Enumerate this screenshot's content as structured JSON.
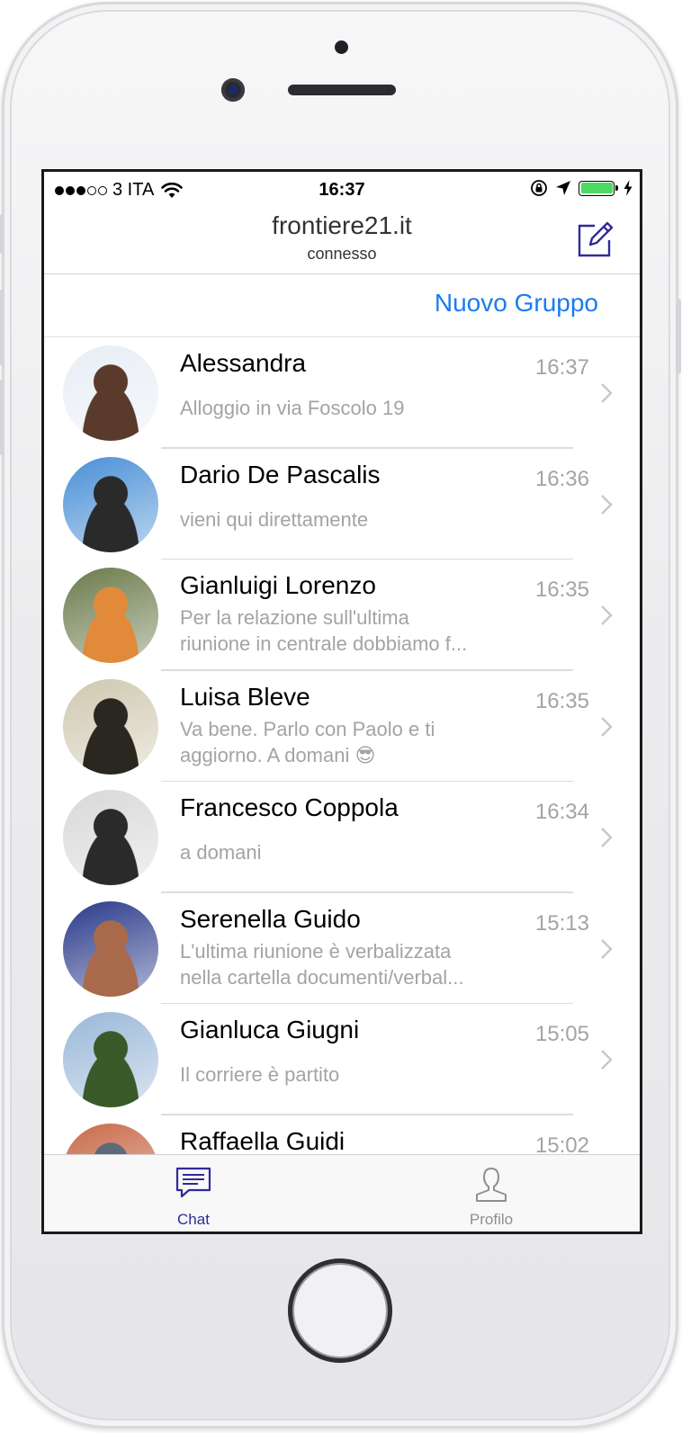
{
  "status_bar": {
    "carrier": "3 ITA",
    "time": "16:37",
    "signal_bars_filled": 3,
    "signal_bars_total": 5,
    "battery_level": 1.0
  },
  "header": {
    "title": "frontiere21.it",
    "subtitle": "connesso",
    "compose_icon": "compose-icon"
  },
  "actions": {
    "new_group_label": "Nuovo Gruppo"
  },
  "conversations": [
    {
      "name": "Alessandra",
      "time": "16:37",
      "preview": [
        "Alloggio in via Foscolo 19"
      ],
      "avatar_colors": [
        "#e8eef5",
        "#5a3a2a"
      ]
    },
    {
      "name": "Dario De Pascalis",
      "time": "16:36",
      "preview": [
        "vieni qui direttamente"
      ],
      "avatar_colors": [
        "#4a8fd6",
        "#2a2a2a"
      ]
    },
    {
      "name": "Gianluigi Lorenzo",
      "time": "16:35",
      "preview": [
        "Per la relazione sull'ultima",
        "riunione in centrale dobbiamo f..."
      ],
      "avatar_colors": [
        "#6a7a4a",
        "#e08a3a"
      ]
    },
    {
      "name": "Luisa Bleve",
      "time": "16:35",
      "preview": [
        "Va bene. Parlo con Paolo e ti",
        "aggiorno. A domani 😎"
      ],
      "avatar_colors": [
        "#cfc8b0",
        "#2a2620"
      ]
    },
    {
      "name": "Francesco Coppola",
      "time": "16:34",
      "preview": [
        "a domani"
      ],
      "avatar_colors": [
        "#d8d8d8",
        "#2a2a2a"
      ]
    },
    {
      "name": "Serenella Guido",
      "time": "15:13",
      "preview": [
        "L'ultima riunione è verbalizzata",
        "nella cartella documenti/verbal..."
      ],
      "avatar_colors": [
        "#2a3a8a",
        "#a86a4a"
      ]
    },
    {
      "name": "Gianluca Giugni",
      "time": "15:05",
      "preview": [
        "Il corriere è partito"
      ],
      "avatar_colors": [
        "#9ab8d8",
        "#3a5a2a"
      ]
    },
    {
      "name": "Raffaella Guidi",
      "time": "15:02",
      "preview": [
        ""
      ],
      "avatar_colors": [
        "#c86a4a",
        "#5a6a7a"
      ]
    }
  ],
  "tabs": [
    {
      "label": "Chat",
      "icon": "chat-bubble-icon",
      "active": true
    },
    {
      "label": "Profilo",
      "icon": "person-icon",
      "active": false
    }
  ],
  "colors": {
    "accent_blue": "#1a7cf0",
    "tab_active": "#2f2a9a",
    "tab_inactive": "#8e8e93",
    "secondary_text": "#a3a3a8",
    "battery_green": "#4cd964"
  }
}
